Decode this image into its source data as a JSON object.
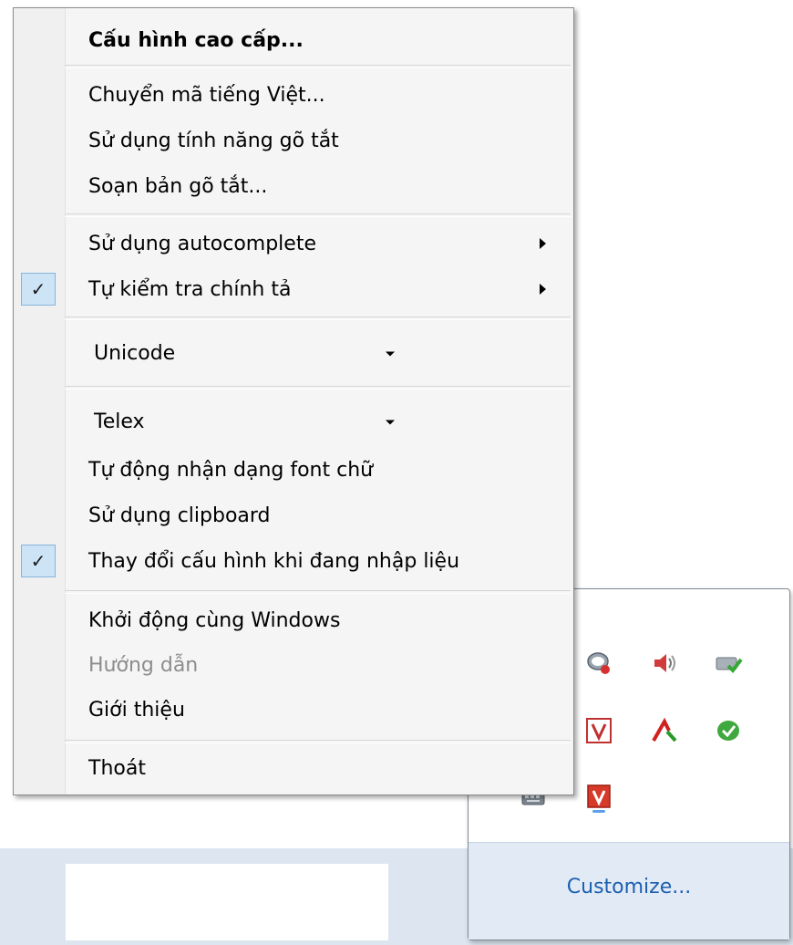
{
  "menu": {
    "advanced_config": "Cấu hình cao cấp...",
    "convert_encoding": "Chuyển mã tiếng Việt...",
    "use_shorthand": "Sử dụng tính năng gõ tắt",
    "edit_shorthand": "Soạn bản gõ tắt...",
    "use_autocomplete": "Sử dụng autocomplete",
    "spell_check": "Tự kiểm tra chính tả",
    "encoding_select": "Unicode",
    "input_method_select": "Telex",
    "auto_detect_font": "Tự động nhận dạng font chữ",
    "use_clipboard": "Sử dụng clipboard",
    "change_config_while_typing": "Thay đổi cấu hình khi đang nhập liệu",
    "start_with_windows": "Khởi động cùng Windows",
    "help": "Hướng dẫn",
    "about": "Giới thiệu",
    "exit": "Thoát",
    "check_mark": "✓"
  },
  "tray": {
    "customize_label": "Customize..."
  },
  "colors": {
    "menu_bg": "#f5f5f5",
    "check_bg": "#cde4f7",
    "disabled_text": "#8d8d8d",
    "link": "#1c5fb0",
    "tray_footer": "#e2ebf5"
  },
  "icons": [
    "chat-bubble-icon",
    "speaker-icon",
    "network-icon",
    "vietkey-v-icon",
    "red-arrow-icon",
    "green-leaf-icon",
    "keyboard-icon",
    "unikey-v-icon"
  ]
}
